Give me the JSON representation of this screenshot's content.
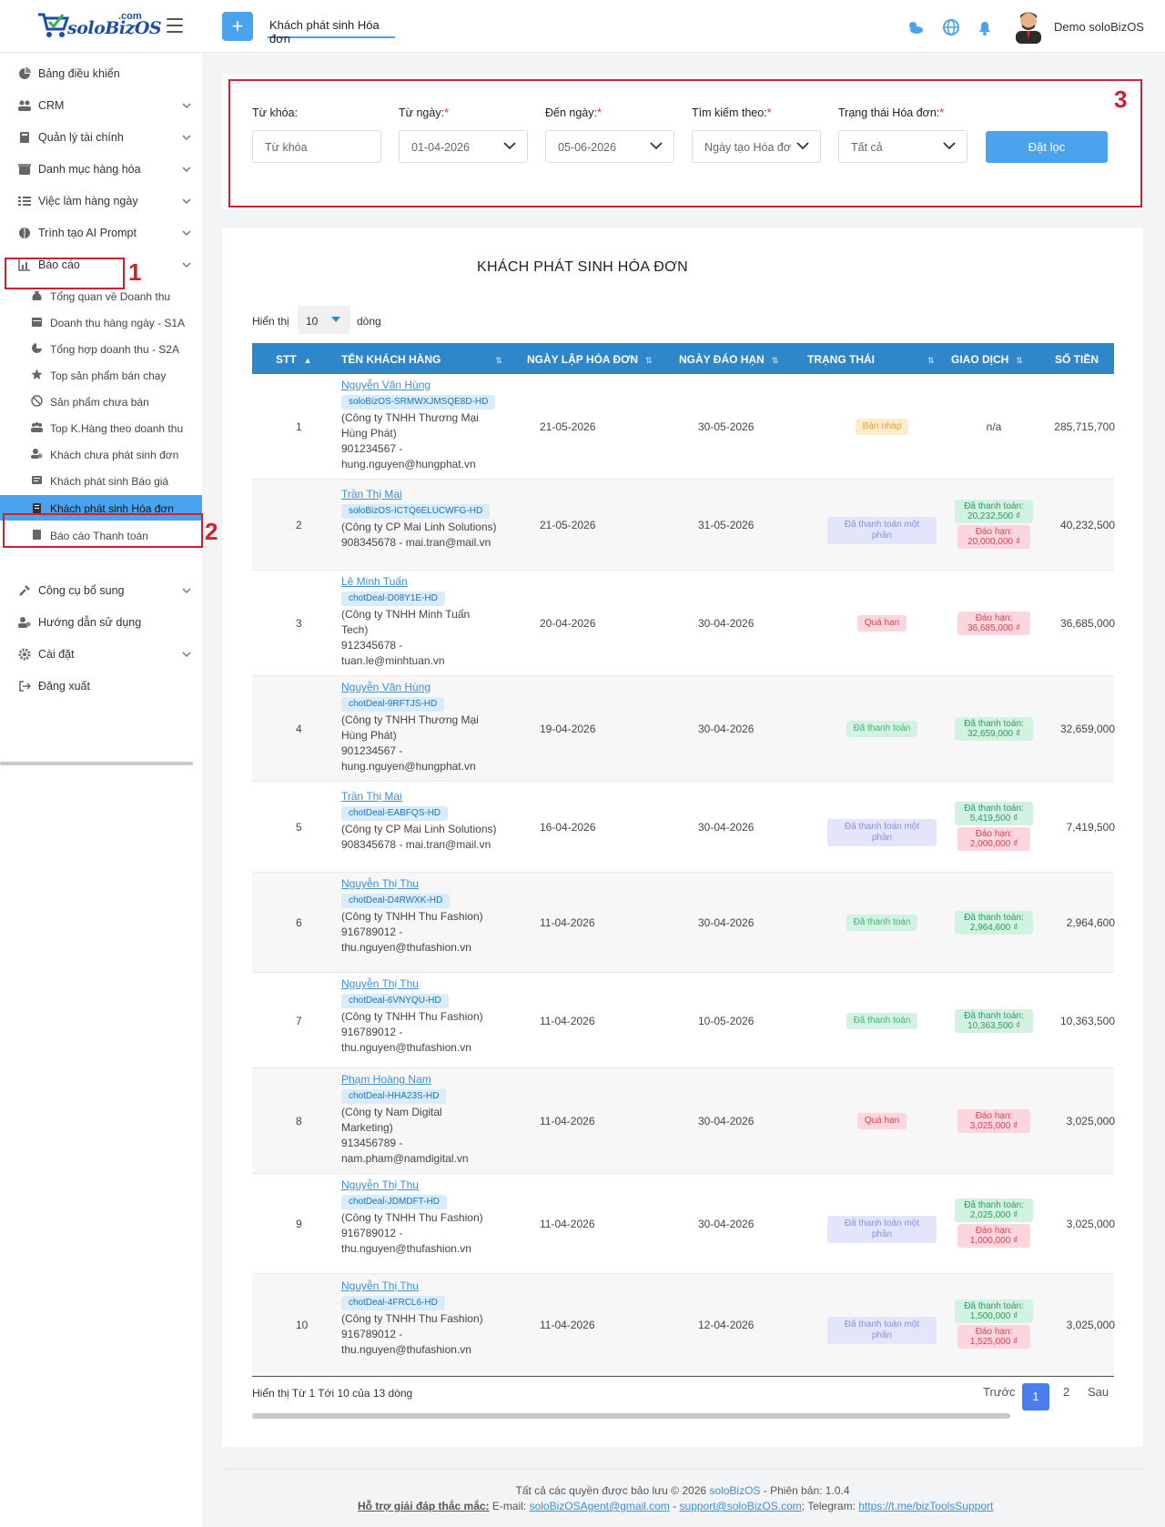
{
  "brand": {
    "name": "soloBizOS",
    "com": ".com"
  },
  "topbar": {
    "tab_label": "Khách phát sinh Hóa đơn",
    "user_name": "Demo soloBizOS"
  },
  "sidebar": {
    "items": [
      {
        "label": "Bảng điều khiển",
        "icon": "dashboard-icon"
      },
      {
        "label": "CRM",
        "icon": "users-icon"
      },
      {
        "label": "Quản lý tài chính",
        "icon": "finance-icon"
      },
      {
        "label": "Danh mục hàng hóa",
        "icon": "box-icon"
      },
      {
        "label": "Việc làm hàng ngày",
        "icon": "tasks-icon"
      },
      {
        "label": "Trình tạo AI Prompt",
        "icon": "ai-icon"
      },
      {
        "label": "Báo cáo",
        "icon": "chart-icon"
      }
    ],
    "report_sub": [
      "Tổng quan về Doanh thu",
      "Doanh thu hàng ngày - S1A",
      "Tổng hợp doanh thu - S2A",
      "Top sản phẩm bán chạy",
      "Sản phẩm chưa bán",
      "Top K.Hàng theo doanh thu",
      "Khách chưa phát sinh đơn",
      "Khách phát sinh Báo giá",
      "Khách phát sinh Hóa đơn",
      "Báo cáo Thanh toán"
    ],
    "bottom_items": [
      {
        "label": "Công cụ bổ sung",
        "icon": "tools-icon"
      },
      {
        "label": "Hướng dẫn sử dụng",
        "icon": "guide-icon"
      },
      {
        "label": "Cài đặt",
        "icon": "settings-icon"
      },
      {
        "label": "Đăng xuất",
        "icon": "logout-icon"
      }
    ]
  },
  "annotations": {
    "one": "1",
    "two": "2",
    "three": "3"
  },
  "filters": {
    "keyword_label": "Từ khóa:",
    "keyword_placeholder": "Từ khóa",
    "from_label": "Từ ngày:",
    "from_value": "01-04-2026",
    "to_label": "Đến ngày:",
    "to_value": "05-06-2026",
    "searchby_label": "Tìm kiếm theo:",
    "searchby_value": "Ngày tạo Hóa đơ",
    "status_label": "Trạng thái Hóa đơn:",
    "status_value": "Tất cả",
    "required_mark": "*",
    "submit_label": "Đặt lọc"
  },
  "table": {
    "title": "KHÁCH PHÁT SINH HÓA ĐƠN",
    "show_label": "Hiển thị",
    "show_value": "10",
    "rows_label": "dòng",
    "columns": [
      "STT",
      "TÊN KHÁCH HÀNG",
      "NGÀY LẬP HÓA ĐƠN",
      "NGÀY ĐÁO HẠN",
      "TRẠNG THÁI",
      "GIAO DỊCH",
      "SỐ TIỀN"
    ],
    "rows": [
      {
        "stt": "1",
        "name": "Nguyễn Văn Hùng",
        "code": "soloBizOS-SRMWXJMSQE8D-HD",
        "info": [
          "(Công ty TNHH Thương Mại",
          "Hùng Phát)",
          "901234567 -",
          "hung.nguyen@hungphat.vn"
        ],
        "created": "21-05-2026",
        "due": "30-05-2026",
        "status": "Bản nháp",
        "status_class": "st-draft",
        "tx": [],
        "tx_text": "n/a",
        "amount": "285,715,700"
      },
      {
        "stt": "2",
        "name": "Trần Thị Mai",
        "code": "soloBizOS-ICTQ6ELUCWFG-HD",
        "info": [
          "(Công ty CP Mai Linh Solutions)",
          "908345678 - mai.tran@mail.vn"
        ],
        "created": "21-05-2026",
        "due": "31-05-2026",
        "status": "Đã thanh toán một phần",
        "status_class": "st-partial",
        "tx": [
          {
            "type": "paid",
            "label": "Đã thanh toán:",
            "value": "20,232,500 ₫"
          },
          {
            "type": "due",
            "label": "Đáo hạn:",
            "value": "20,000,000 ₫"
          }
        ],
        "amount": "40,232,500"
      },
      {
        "stt": "3",
        "name": "Lê Minh Tuấn",
        "code": "chotDeal-D08Y1E-HD",
        "info": [
          "(Công ty TNHH Minh Tuấn",
          "Tech)",
          "912345678 -",
          "tuan.le@minhtuan.vn"
        ],
        "created": "20-04-2026",
        "due": "30-04-2026",
        "status": "Quá hạn",
        "status_class": "st-over",
        "tx": [
          {
            "type": "due",
            "label": "Đáo hạn:",
            "value": "36,685,000 ₫"
          }
        ],
        "amount": "36,685,000"
      },
      {
        "stt": "4",
        "name": "Nguyễn Văn Hùng",
        "code": "chotDeal-9RFTJS-HD",
        "info": [
          "(Công ty TNHH Thương Mại",
          "Hùng Phát)",
          "901234567 -",
          "hung.nguyen@hungphat.vn"
        ],
        "created": "19-04-2026",
        "due": "30-04-2026",
        "status": "Đã thanh toán",
        "status_class": "st-paid",
        "tx": [
          {
            "type": "paid",
            "label": "Đã thanh toán:",
            "value": "32,659,000 ₫"
          }
        ],
        "amount": "32,659,000"
      },
      {
        "stt": "5",
        "name": "Trần Thị Mai",
        "code": "chotDeal-EABFQS-HD",
        "info": [
          "(Công ty CP Mai Linh Solutions)",
          "908345678 - mai.tran@mail.vn"
        ],
        "created": "16-04-2026",
        "due": "30-04-2026",
        "status": "Đã thanh toán một phần",
        "status_class": "st-partial",
        "tx": [
          {
            "type": "paid",
            "label": "Đã thanh toán:",
            "value": "5,419,500 ₫"
          },
          {
            "type": "due",
            "label": "Đáo hạn:",
            "value": "2,000,000 ₫"
          }
        ],
        "amount": "7,419,500"
      },
      {
        "stt": "6",
        "name": "Nguyễn Thị Thu",
        "code": "chotDeal-D4RWXK-HD",
        "info": [
          "(Công ty TNHH Thu Fashion)",
          "916789012 -",
          "thu.nguyen@thufashion.vn"
        ],
        "created": "11-04-2026",
        "due": "30-04-2026",
        "status": "Đã thanh toán",
        "status_class": "st-paid",
        "tx": [
          {
            "type": "paid",
            "label": "Đã thanh toán:",
            "value": "2,964,600 ₫"
          }
        ],
        "amount": "2,964,600"
      },
      {
        "stt": "7",
        "name": "Nguyễn Thị Thu",
        "code": "chotDeal-6VNYQU-HD",
        "info": [
          "(Công ty TNHH Thu Fashion)",
          "916789012 -",
          "thu.nguyen@thufashion.vn"
        ],
        "created": "11-04-2026",
        "due": "10-05-2026",
        "status": "Đã thanh toán",
        "status_class": "st-paid",
        "tx": [
          {
            "type": "paid",
            "label": "Đã thanh toán:",
            "value": "10,363,500 ₫"
          }
        ],
        "amount": "10,363,500"
      },
      {
        "stt": "8",
        "name": "Phạm Hoàng Nam",
        "code": "chotDeal-HHA23S-HD",
        "info": [
          "(Công ty Nam Digital",
          "Marketing)",
          "913456789 -",
          "nam.pham@namdigital.vn"
        ],
        "created": "11-04-2026",
        "due": "30-04-2026",
        "status": "Quá hạn",
        "status_class": "st-over",
        "tx": [
          {
            "type": "due",
            "label": "Đáo hạn:",
            "value": "3,025,000 ₫"
          }
        ],
        "amount": "3,025,000"
      },
      {
        "stt": "9",
        "name": "Nguyễn Thị Thu",
        "code": "chotDeal-JDMDFT-HD",
        "info": [
          "(Công ty TNHH Thu Fashion)",
          "916789012 -",
          "thu.nguyen@thufashion.vn"
        ],
        "created": "11-04-2026",
        "due": "30-04-2026",
        "status": "Đã thanh toán một phần",
        "status_class": "st-partial",
        "tx": [
          {
            "type": "paid",
            "label": "Đã thanh toán:",
            "value": "2,025,000 ₫"
          },
          {
            "type": "due",
            "label": "Đáo hạn:",
            "value": "1,000,000 ₫"
          }
        ],
        "amount": "3,025,000"
      },
      {
        "stt": "10",
        "name": "Nguyễn Thị Thu",
        "code": "chotDeal-4FRCL6-HD",
        "info": [
          "(Công ty TNHH Thu Fashion)",
          "916789012 -",
          "thu.nguyen@thufashion.vn"
        ],
        "created": "11-04-2026",
        "due": "12-04-2026",
        "status": "Đã thanh toán một phần",
        "status_class": "st-partial",
        "tx": [
          {
            "type": "paid",
            "label": "Đã thanh toán:",
            "value": "1,500,000 ₫"
          },
          {
            "type": "due",
            "label": "Đáo hạn:",
            "value": "1,525,000 ₫"
          }
        ],
        "amount": "3,025,000"
      }
    ],
    "page_info": "Hiển thị Từ 1 Tới 10 của 13 dòng",
    "pager": {
      "prev": "Trước",
      "p1": "1",
      "p2": "2",
      "next": "Sau"
    }
  },
  "footer": {
    "copyright_prefix": "Tất cả các quyền được bảo lưu © 2026",
    "brand": "soloBizOS",
    "version": "- Phiên bản: 1.0.4",
    "support_label": "Hỗ trợ giải đáp thắc mắc:",
    "email_prefix": "E-mail:",
    "email1": "soloBizOSAgent@gmail.com",
    "dash": "-",
    "email2": "support@soloBizOS.com",
    "tg_prefix": "; Telegram:",
    "telegram": "https://t.me/bizToolsSupport"
  },
  "colors": {
    "accent": "#4aa3ec",
    "header": "#2f86c9",
    "annotation": "#d0202f"
  }
}
